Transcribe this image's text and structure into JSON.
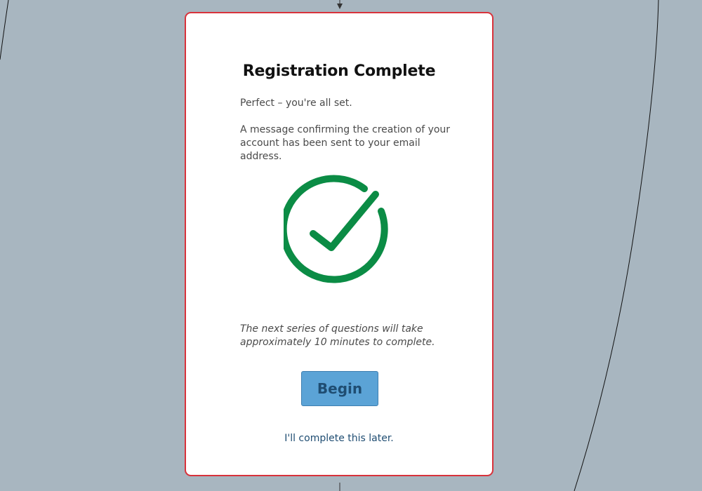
{
  "dialog": {
    "title": "Registration Complete",
    "intro_text": "Perfect – you're all set.",
    "confirmation_text": "A message confirming the creation of your account has been sent to your email address.",
    "icon": "check-circle-icon",
    "note_text": "The next series of questions will take approximately 10 minutes to complete.",
    "begin_label": "Begin",
    "later_label": "I'll complete this later."
  },
  "colors": {
    "background": "#a8b6c0",
    "card_border": "#d8323b",
    "check_green": "#0b8c45",
    "button_fill": "#5ba3d6",
    "button_text": "#1f4d72",
    "link_text": "#1f4d72"
  }
}
